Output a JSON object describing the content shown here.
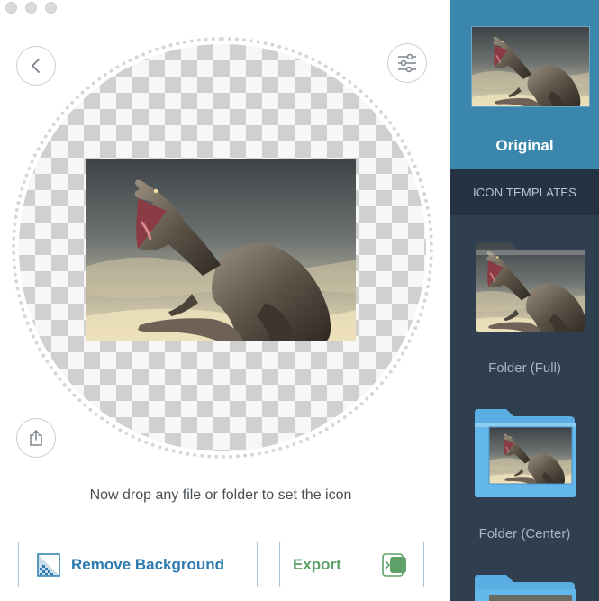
{
  "editor": {
    "drop_hint": "Now drop any file or folder to set the icon",
    "remove_background_label": "Remove Background",
    "export_label": "Export"
  },
  "sidebar": {
    "original_label": "Original",
    "templates_header": "ICON TEMPLATES",
    "templates": [
      {
        "label": "Folder (Full)"
      },
      {
        "label": "Folder (Center)"
      }
    ]
  },
  "colors": {
    "sidebar_bg": "#2f3f4f",
    "original_tile_bg": "#3a86ad",
    "accent_blue": "#2d7bb0",
    "export_green": "#5ea26a",
    "folder_blue": "#64b7ea"
  },
  "icons": [
    "back-icon",
    "settings-sliders-icon",
    "share-icon",
    "remove-background-icon",
    "export-icon"
  ]
}
